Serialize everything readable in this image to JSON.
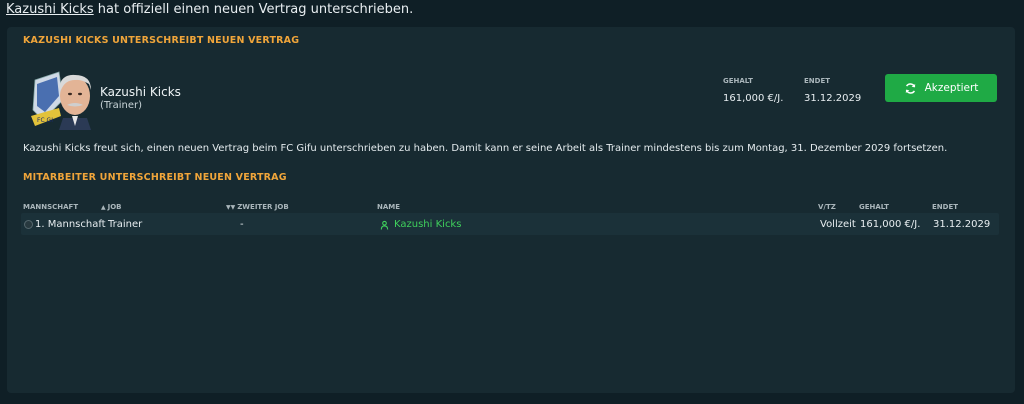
{
  "headline": {
    "name": "Kazushi Kicks",
    "text": " hat offiziell einen neuen Vertrag unterschrieben."
  },
  "panel": {
    "title": "KAZUSHI KICKS UNTERSCHREIBT NEUEN VERTRAG",
    "person": {
      "name": "Kazushi Kicks",
      "role": "(Trainer)",
      "badge_text": "FC GI"
    },
    "salary_label": "GEHALT",
    "salary_value": "161,000 €/J.",
    "ends_label": "ENDET",
    "ends_value": "31.12.2029",
    "accept_label": "Akzeptiert",
    "description": "Kazushi Kicks freut sich, einen neuen Vertrag beim FC Gifu unterschrieben zu haben. Damit kann er seine Arbeit als Trainer mindestens bis zum Montag, 31. Dezember 2029 fortsetzen."
  },
  "staff": {
    "title": "MITARBEITER UNTERSCHREIBT NEUEN VERTRAG",
    "columns": {
      "team": "MANNSCHAFT",
      "job": "JOB",
      "second_job": "ZWEITER JOB",
      "name": "NAME",
      "vtz": "V/TZ",
      "salary": "GEHALT",
      "ends": "ENDET"
    },
    "rows": [
      {
        "team": "1. Mannschaft",
        "job": "Trainer",
        "second_job": "-",
        "name": "Kazushi Kicks",
        "vtz": "Vollzeit",
        "salary": "161,000 €/J.",
        "ends": "31.12.2029"
      }
    ]
  },
  "colors": {
    "accent_orange": "#f0a53a",
    "accept_green": "#1faa45",
    "link_green": "#3fd05c",
    "background": "#0f1f26",
    "panel": "#172a31"
  },
  "icons": [
    "refresh-icon",
    "person-icon",
    "status-dot-icon"
  ]
}
